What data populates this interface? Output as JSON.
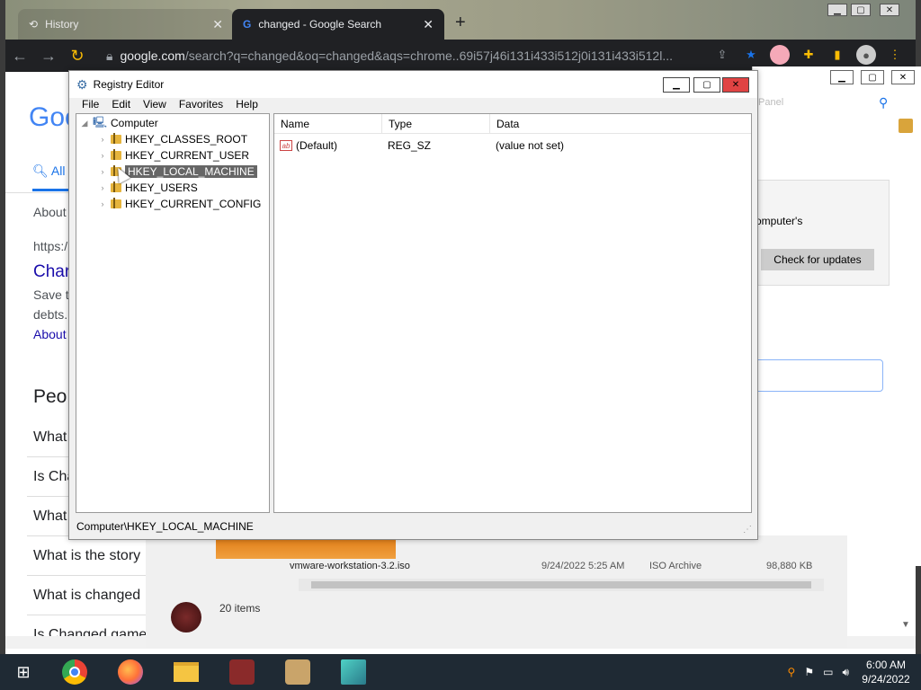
{
  "browser": {
    "tabs": [
      {
        "label": "History"
      },
      {
        "label": "changed - Google Search"
      }
    ],
    "new_tab": "+",
    "url_host": "google.com",
    "url_rest": "/search?q=changed&oq=changed&aqs=chrome..69i57j46i131i433i512j0i131i433i512l...",
    "win_min": "▁",
    "win_max": "▢",
    "win_close": "✕"
  },
  "google_page": {
    "logo": "Goo",
    "tab_all": "All",
    "about": "About",
    "url_fragment": "https:/",
    "result_title": "Char",
    "snippet1": "Save t",
    "snippet2": "debts.",
    "about2": "About",
    "people_heading": "Peo",
    "questions": [
      "What",
      "Is Cha",
      "What",
      "What is the story",
      "What is changed",
      "Is Changed game"
    ]
  },
  "settings_window": {
    "panel_hint": "Panel",
    "computers": "omputer's",
    "check_updates": "Check for updates"
  },
  "explorer": {
    "file_name": "vmware-workstation-3.2.iso",
    "file_date": "9/24/2022 5:25 AM",
    "file_type": "ISO Archive",
    "file_size": "98,880 KB",
    "items": "20 items"
  },
  "regedit": {
    "title": "Registry Editor",
    "menu": [
      "File",
      "Edit",
      "View",
      "Favorites",
      "Help"
    ],
    "tree": {
      "root": "Computer",
      "keys": [
        "HKEY_CLASSES_ROOT",
        "HKEY_CURRENT_USER",
        "HKEY_LOCAL_MACHINE",
        "HKEY_USERS",
        "HKEY_CURRENT_CONFIG"
      ]
    },
    "columns": [
      "Name",
      "Type",
      "Data"
    ],
    "rows": [
      {
        "name": "(Default)",
        "type": "REG_SZ",
        "data": "(value not set)"
      }
    ],
    "status_path": "Computer\\HKEY_LOCAL_MACHINE"
  },
  "taskbar": {
    "time": "6:00 AM",
    "date": "9/24/2022"
  }
}
